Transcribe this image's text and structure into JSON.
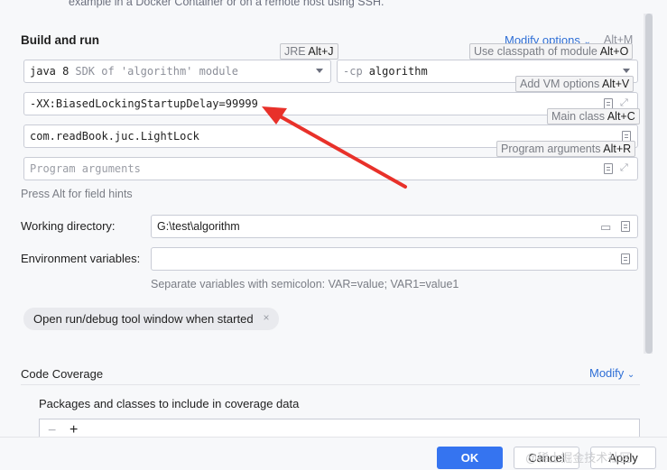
{
  "top_text": "example in a Docker Container or on a remote host using SSH.",
  "section_title": "Build and run",
  "modify_options": {
    "label": "Modify options",
    "shortcut": "Alt+M"
  },
  "jre": {
    "name": "java 8",
    "detail": "SDK of 'algorithm' module"
  },
  "classpath": {
    "prefix": "-cp",
    "value": "algorithm"
  },
  "vm_options": "-XX:BiasedLockingStartupDelay=99999",
  "main_class": "com.readBook.juc.LightLock",
  "program_args_placeholder": "Program arguments",
  "field_hint": "Press Alt for field hints",
  "working_dir": {
    "label": "Working directory:",
    "value": "G:\\test\\algorithm"
  },
  "env_vars": {
    "label": "Environment variables:",
    "value": "",
    "hint": "Separate variables with semicolon: VAR=value; VAR1=value1"
  },
  "open_tool_window_chip": "Open run/debug tool window when started",
  "tooltips": {
    "jre": {
      "text": "JRE",
      "key": "Alt+J"
    },
    "classpath": {
      "text": "Use classpath of module",
      "key": "Alt+O"
    },
    "vm": {
      "text": "Add VM options",
      "key": "Alt+V"
    },
    "main": {
      "text": "Main class",
      "key": "Alt+C"
    },
    "args": {
      "text": "Program arguments",
      "key": "Alt+R"
    }
  },
  "coverage": {
    "title": "Code Coverage",
    "modify": "Modify",
    "packages_label": "Packages and classes to include in coverage data"
  },
  "list_toolbar": {
    "remove": "−",
    "add": "+"
  },
  "buttons": {
    "ok": "OK",
    "cancel": "Cancel",
    "apply": "Apply"
  },
  "watermark": "@稀土掘金技术社区",
  "colors": {
    "accent": "#3574f0",
    "annotation_arrow": "#e8312a",
    "link": "#2f6fd6"
  }
}
